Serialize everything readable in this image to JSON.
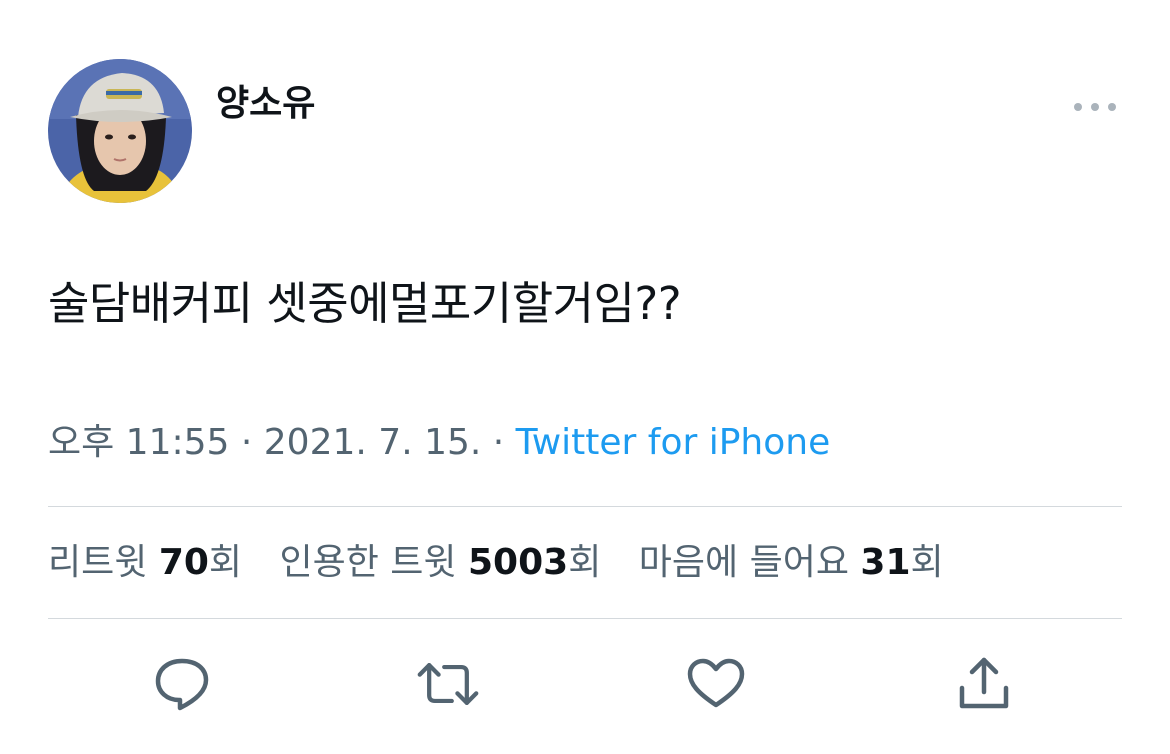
{
  "author": {
    "display_name": "양소유"
  },
  "tweet": {
    "text": "술담배커피 셋중에멀포기할거임??"
  },
  "meta": {
    "time": "오후 11:55",
    "separator_1": " · ",
    "date": "2021. 7. 15.",
    "separator_2": " · ",
    "source": "Twitter for iPhone"
  },
  "stats": {
    "retweets": {
      "label": "리트윗 ",
      "value": "70",
      "suffix": "회"
    },
    "quotes": {
      "label": "인용한 트윗 ",
      "value": "5003",
      "suffix": "회"
    },
    "likes": {
      "label": "마음에 들어요 ",
      "value": "31",
      "suffix": "회"
    }
  },
  "icons": {
    "more": "more-horizontal-icon",
    "reply": "reply-icon",
    "retweet": "retweet-icon",
    "like": "heart-icon",
    "share": "share-icon"
  },
  "colors": {
    "text": "#0f1419",
    "secondary": "#536471",
    "link": "#1d9bf0",
    "divider": "#d4d9dd"
  }
}
